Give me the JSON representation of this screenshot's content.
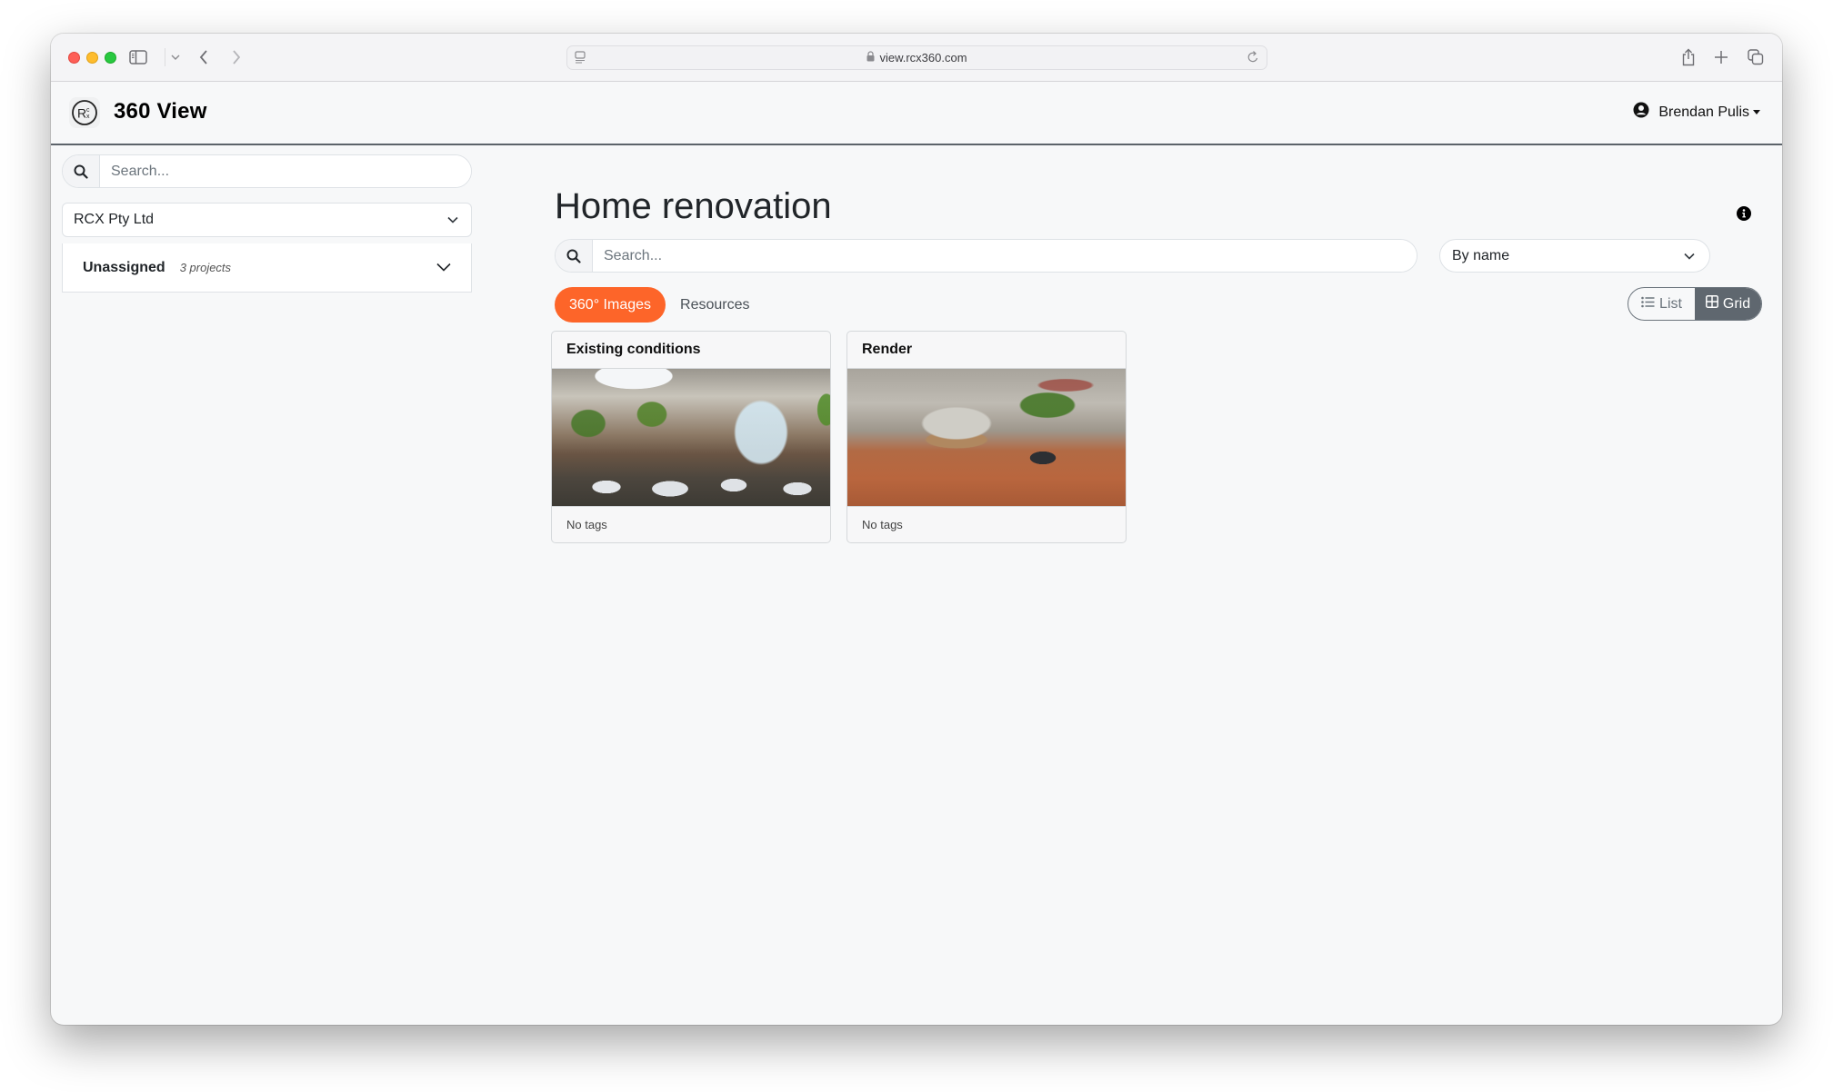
{
  "browser": {
    "url": "view.rcx360.com",
    "icons": {
      "sidebar": "sidebar-icon",
      "tab_overview_chevron": "chevron-down-icon",
      "back": "chevron-left-icon",
      "forward": "chevron-right-icon",
      "page": "page-menu-icon",
      "lock": "lock-icon",
      "reload": "reload-icon",
      "share": "share-icon",
      "new_tab": "plus-icon",
      "tabs": "tab-overview-icon"
    }
  },
  "header": {
    "app_title": "360 View",
    "logo_text": "RCX",
    "user_name": "Brendan Pulis"
  },
  "sidebar": {
    "search_placeholder": "Search...",
    "company": "RCX Pty Ltd",
    "groups": [
      {
        "title": "Unassigned",
        "count": "3 projects"
      }
    ]
  },
  "main": {
    "title": "Home renovation",
    "search_placeholder": "Search...",
    "sort": "By name",
    "tabs": [
      {
        "label": "360° Images",
        "active": true
      },
      {
        "label": "Resources",
        "active": false
      }
    ],
    "view_toggle": [
      {
        "label": "List",
        "active": false
      },
      {
        "label": "Grid",
        "active": true
      }
    ],
    "cards": [
      {
        "title": "Existing conditions",
        "tags": "No tags"
      },
      {
        "title": "Render",
        "tags": "No tags"
      }
    ]
  },
  "colors": {
    "accent": "#fd6529",
    "toggle_active": "#5f676f",
    "header_border": "#5c636a"
  }
}
